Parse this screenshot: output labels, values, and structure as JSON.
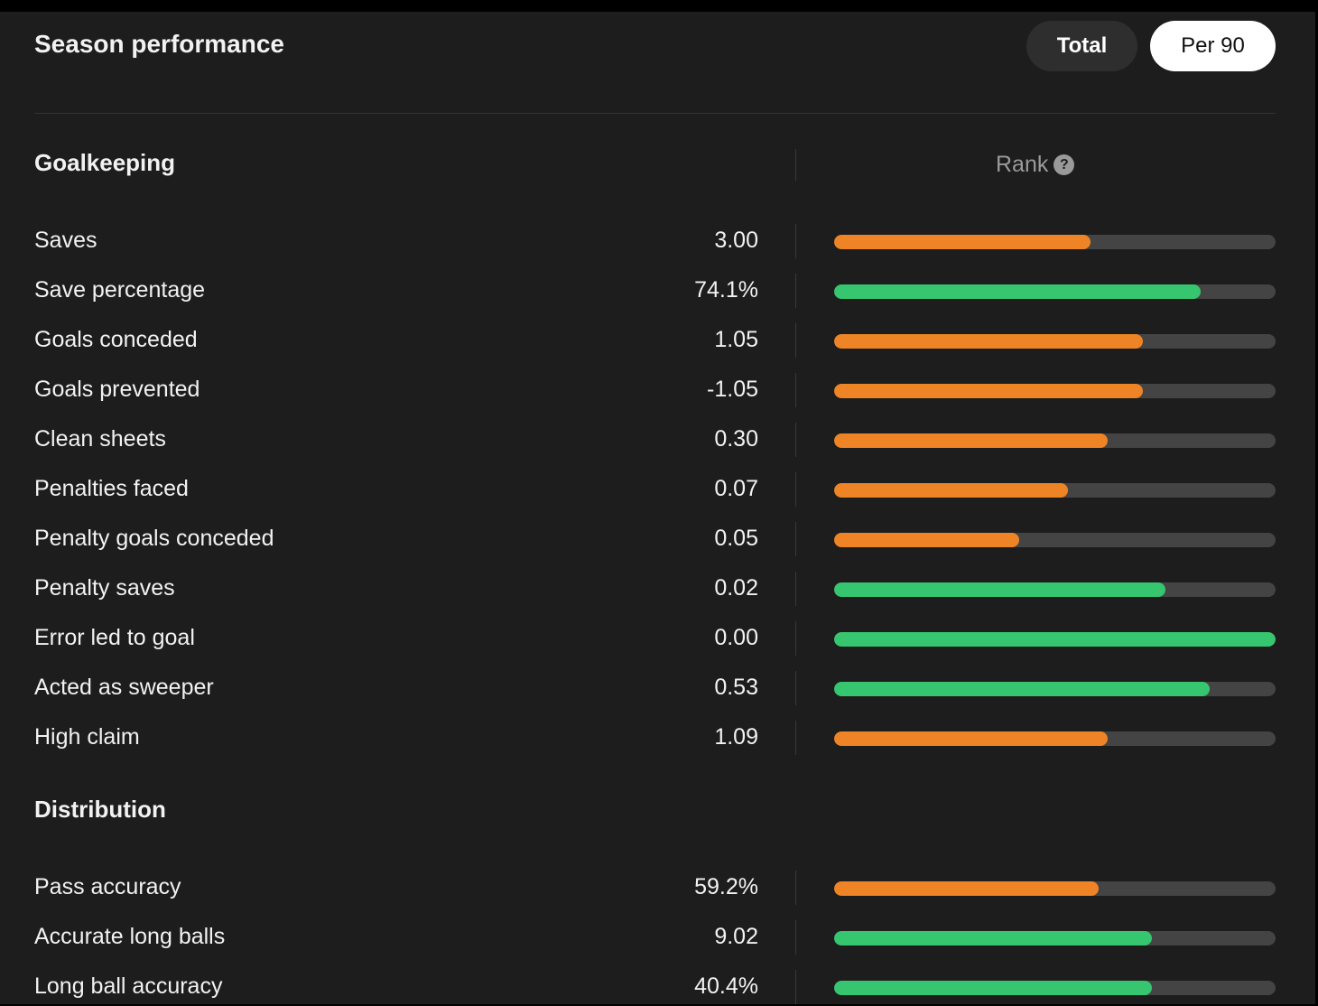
{
  "header": {
    "title": "Season performance",
    "toggle": [
      {
        "label": "Total",
        "active": false
      },
      {
        "label": "Per 90",
        "active": true
      }
    ]
  },
  "rank_label": "Rank",
  "rank_help_icon": "?",
  "colors": {
    "good": "#36c66f",
    "bad": "#ef8426",
    "track": "#444444"
  },
  "sections": [
    {
      "title": "Goalkeeping",
      "rows": [
        {
          "label": "Saves",
          "value": "3.00",
          "rank_pct": 58,
          "color": "bad"
        },
        {
          "label": "Save percentage",
          "value": "74.1%",
          "rank_pct": 83,
          "color": "good"
        },
        {
          "label": "Goals conceded",
          "value": "1.05",
          "rank_pct": 70,
          "color": "bad"
        },
        {
          "label": "Goals prevented",
          "value": "-1.05",
          "rank_pct": 70,
          "color": "bad"
        },
        {
          "label": "Clean sheets",
          "value": "0.30",
          "rank_pct": 62,
          "color": "bad"
        },
        {
          "label": "Penalties faced",
          "value": "0.07",
          "rank_pct": 53,
          "color": "bad"
        },
        {
          "label": "Penalty goals conceded",
          "value": "0.05",
          "rank_pct": 42,
          "color": "bad"
        },
        {
          "label": "Penalty saves",
          "value": "0.02",
          "rank_pct": 75,
          "color": "good"
        },
        {
          "label": "Error led to goal",
          "value": "0.00",
          "rank_pct": 100,
          "color": "good"
        },
        {
          "label": "Acted as sweeper",
          "value": "0.53",
          "rank_pct": 85,
          "color": "good"
        },
        {
          "label": "High claim",
          "value": "1.09",
          "rank_pct": 62,
          "color": "bad"
        }
      ]
    },
    {
      "title": "Distribution",
      "rows": [
        {
          "label": "Pass accuracy",
          "value": "59.2%",
          "rank_pct": 60,
          "color": "bad"
        },
        {
          "label": "Accurate long balls",
          "value": "9.02",
          "rank_pct": 72,
          "color": "good"
        },
        {
          "label": "Long ball accuracy",
          "value": "40.4%",
          "rank_pct": 72,
          "color": "good"
        }
      ]
    }
  ]
}
